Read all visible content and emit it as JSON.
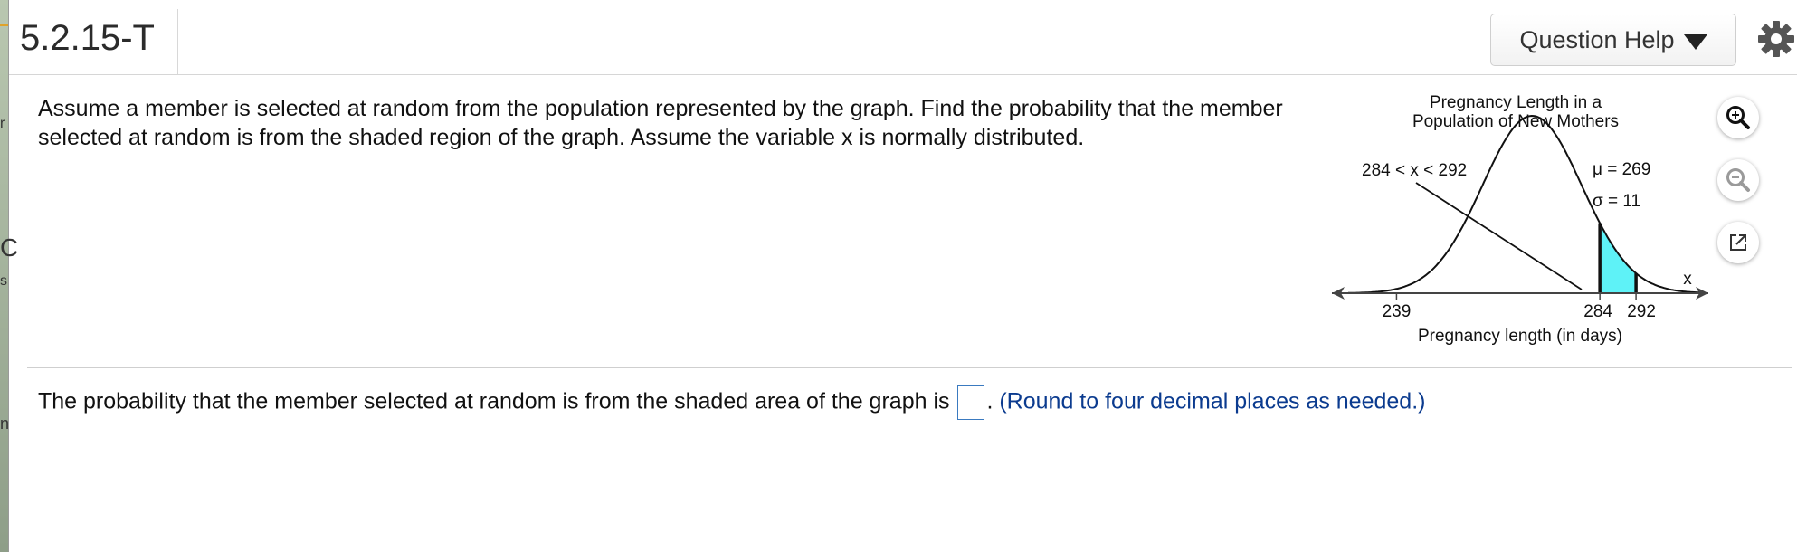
{
  "header": {
    "question_id": "5.2.15-T",
    "help_label": "Question Help"
  },
  "question": {
    "text": "Assume a member is selected at random from the population represented by the graph. Find the probability that the member selected at random is from the shaded region of the graph. Assume the variable x is normally distributed."
  },
  "graph": {
    "title_line1": "Pregnancy Length in a",
    "title_line2": "Population of New Mothers",
    "range_label": "284 < x < 292",
    "mu_label": "μ = 269",
    "sigma_label": "σ = 11",
    "axis_var": "x",
    "tick_left": "239",
    "tick_mid": "284",
    "tick_right": "292",
    "xlabel": "Pregnancy length (in days)",
    "shade_color": "#5ef2f7"
  },
  "answer": {
    "prefix": "The probability that the member selected at random is from the shaded area of the graph is",
    "suffix": ".",
    "hint": "(Round to four decimal places as needed.)"
  },
  "sidebar": {
    "glyphs": [
      "r",
      "C",
      "s",
      "n"
    ]
  }
}
